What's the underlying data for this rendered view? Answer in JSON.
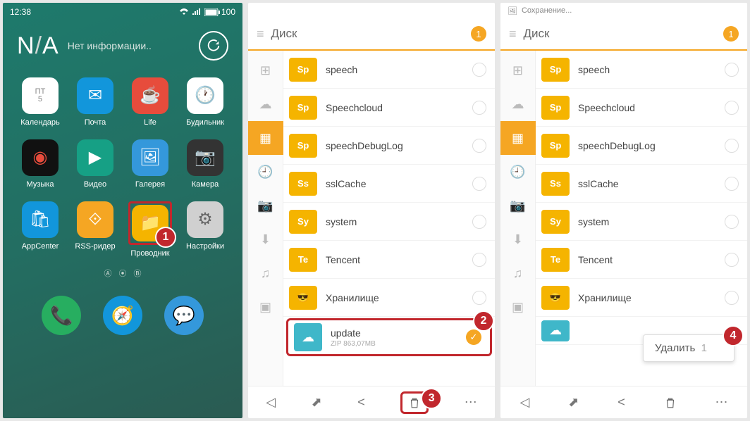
{
  "screen1": {
    "status": {
      "time": "12:38",
      "battery": "100"
    },
    "widget": {
      "na": "N/A",
      "info": "Нет информации..",
      "refresh_icon": "↻"
    },
    "apps": [
      {
        "name": "calendar-icon",
        "label": "Календарь",
        "bg": "#ffffff",
        "glyph": "ПТ\n5",
        "fg": "#888"
      },
      {
        "name": "mail-icon",
        "label": "Почта",
        "bg": "#1296db",
        "glyph": "✉",
        "fg": "#fff"
      },
      {
        "name": "life-icon",
        "label": "Life",
        "bg": "#e74c3c",
        "glyph": "☕",
        "fg": "#fff"
      },
      {
        "name": "alarm-icon",
        "label": "Будильник",
        "bg": "#ffffff",
        "glyph": "🕐",
        "fg": "#333"
      },
      {
        "name": "music-icon",
        "label": "Музыка",
        "bg": "#111111",
        "glyph": "◉",
        "fg": "#e74c3c"
      },
      {
        "name": "video-icon",
        "label": "Видео",
        "bg": "#16a085",
        "glyph": "▶",
        "fg": "#fff"
      },
      {
        "name": "gallery-icon",
        "label": "Галерея",
        "bg": "#3498db",
        "glyph": "🖼",
        "fg": "#fff"
      },
      {
        "name": "camera-icon",
        "label": "Камера",
        "bg": "#333333",
        "glyph": "📷",
        "fg": "#fff"
      },
      {
        "name": "appcenter-icon",
        "label": "AppCenter",
        "bg": "#1296db",
        "glyph": "🛍",
        "fg": "#fff"
      },
      {
        "name": "rss-icon",
        "label": "RSS-ридер",
        "bg": "#f5a623",
        "glyph": "⟐",
        "fg": "#fff"
      },
      {
        "name": "explorer-icon",
        "label": "Проводник",
        "bg": "#f5b400",
        "glyph": "📁",
        "fg": "#fff",
        "highlight": true,
        "badge": "1"
      },
      {
        "name": "settings-icon",
        "label": "Настройки",
        "bg": "#d0d0d0",
        "glyph": "⚙",
        "fg": "#666"
      }
    ],
    "dock": [
      {
        "name": "phone-icon",
        "bg": "#27ae60",
        "glyph": "📞"
      },
      {
        "name": "browser-icon",
        "bg": "#1296db",
        "glyph": "🧭"
      },
      {
        "name": "sms-icon",
        "bg": "#3498db",
        "glyph": "💬"
      }
    ]
  },
  "fm": {
    "title": "Диск",
    "count": "1",
    "sidebar_icons": [
      "⊞",
      "☁",
      "▦",
      "🕘",
      "📷",
      "⬇",
      "♫",
      "▣"
    ],
    "files": [
      {
        "icon_text": "Sp",
        "name": "speech"
      },
      {
        "icon_text": "Sp",
        "name": "Speechcloud"
      },
      {
        "icon_text": "Sp",
        "name": "speechDebugLog"
      },
      {
        "icon_text": "Ss",
        "name": "sslCache"
      },
      {
        "icon_text": "Sy",
        "name": "system"
      },
      {
        "icon_text": "Te",
        "name": "Tencent"
      },
      {
        "icon_text": "😎",
        "name": "Хранилище",
        "cool": true
      }
    ],
    "update_file": {
      "name": "update",
      "sub": "ZIP 863,07MB"
    },
    "badge2": "2",
    "badge3": "3",
    "badge4": "4",
    "saving_text": "Сохранение...",
    "delete_label": "Удалить",
    "delete_count": "1"
  }
}
